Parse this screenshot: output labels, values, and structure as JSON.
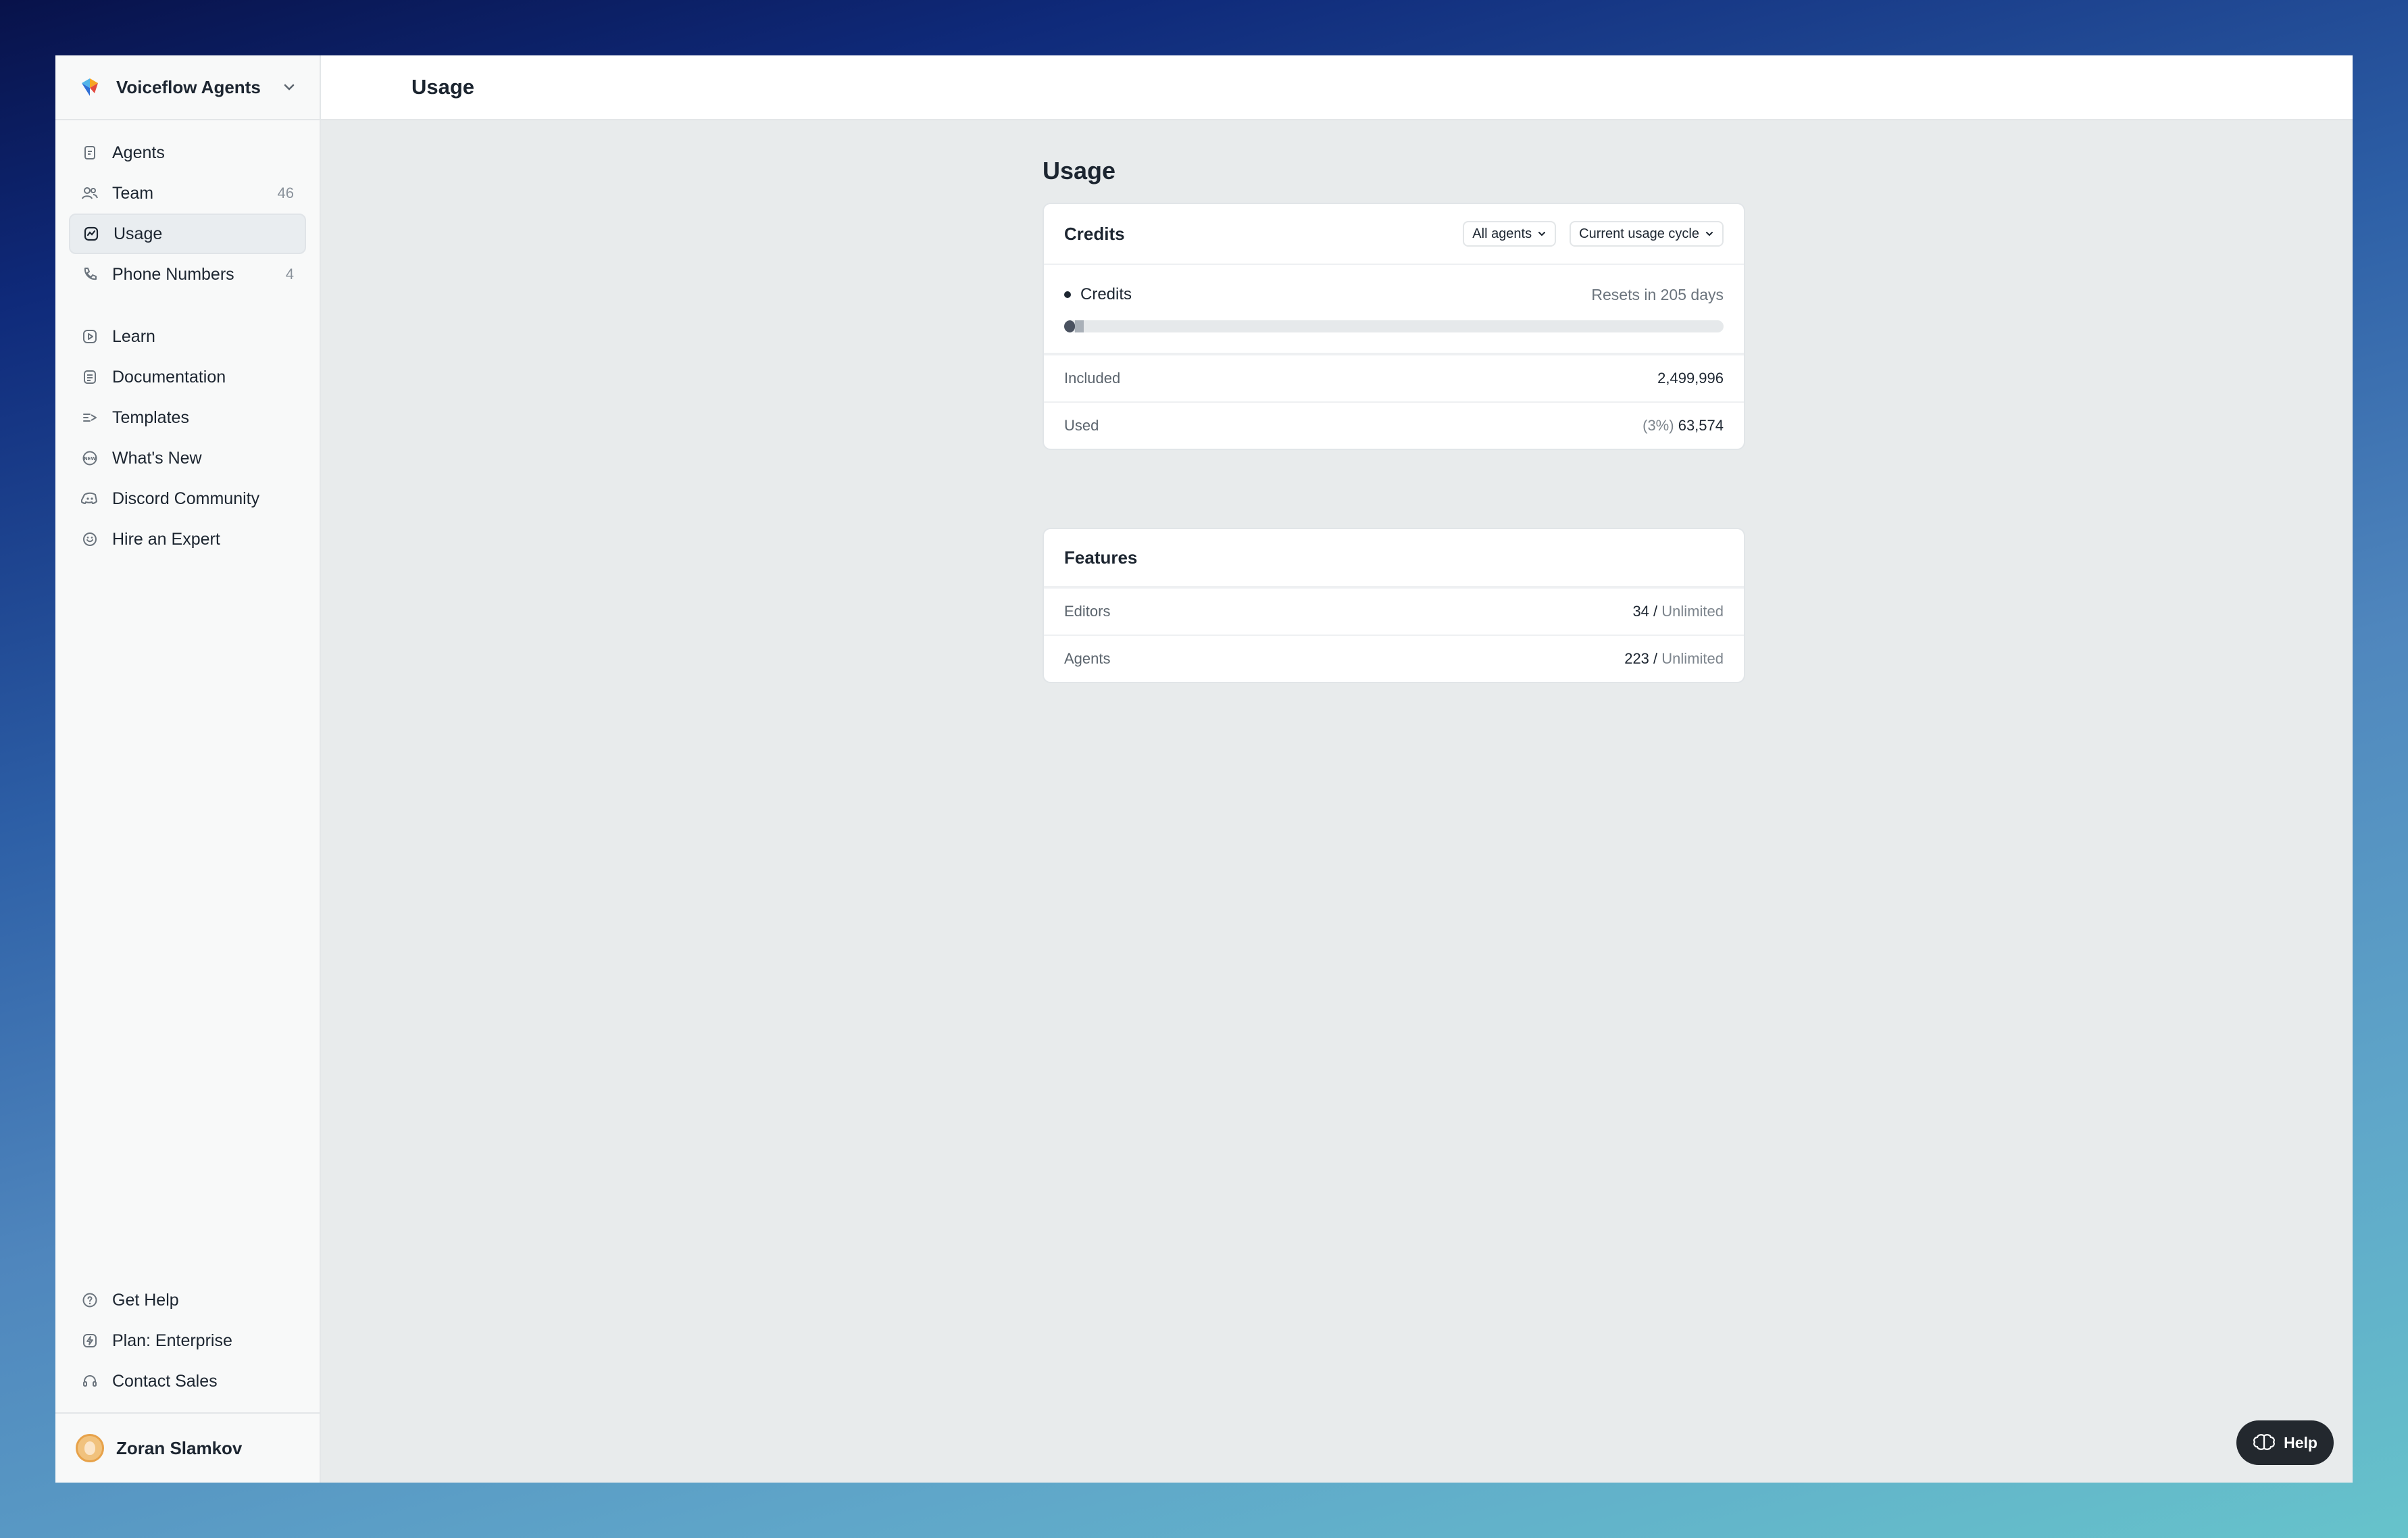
{
  "workspace": {
    "name": "Voiceflow Agents"
  },
  "sidebar": {
    "items": [
      {
        "label": "Agents",
        "icon": "agents-icon",
        "count": ""
      },
      {
        "label": "Team",
        "icon": "team-icon",
        "count": "46"
      },
      {
        "label": "Usage",
        "icon": "usage-icon",
        "count": "",
        "active": true
      },
      {
        "label": "Phone Numbers",
        "icon": "phone-icon",
        "count": "4"
      }
    ],
    "resources": [
      {
        "label": "Learn",
        "icon": "play-icon"
      },
      {
        "label": "Documentation",
        "icon": "documentation-icon"
      },
      {
        "label": "Templates",
        "icon": "templates-icon"
      },
      {
        "label": "What's New",
        "icon": "new-badge-icon"
      },
      {
        "label": "Discord Community",
        "icon": "discord-icon"
      },
      {
        "label": "Hire an Expert",
        "icon": "expert-icon"
      }
    ],
    "bottom": [
      {
        "label": "Get Help",
        "icon": "help-circle-icon"
      },
      {
        "label": "Plan: Enterprise",
        "icon": "plan-icon"
      },
      {
        "label": "Contact Sales",
        "icon": "headset-icon"
      }
    ]
  },
  "user": {
    "name": "Zoran Slamkov"
  },
  "header": {
    "title": "Usage"
  },
  "page": {
    "title": "Usage"
  },
  "credits": {
    "title": "Credits",
    "filter_agents": "All agents",
    "filter_cycle": "Current usage cycle",
    "legend_label": "Credits",
    "resets": "Resets in 205 days",
    "used_fraction": 0.03,
    "included_label": "Included",
    "included_value": "2,499,996",
    "used_label": "Used",
    "used_percent": "(3%)",
    "used_value": "63,574"
  },
  "features": {
    "title": "Features",
    "rows": [
      {
        "label": "Editors",
        "value": "34",
        "sep": "/",
        "limit": "Unlimited"
      },
      {
        "label": "Agents",
        "value": "223",
        "sep": "/",
        "limit": "Unlimited"
      }
    ]
  },
  "help_button": {
    "label": "Help"
  },
  "colors": {
    "accent": "#1c2530",
    "background": "#e8ebec"
  }
}
